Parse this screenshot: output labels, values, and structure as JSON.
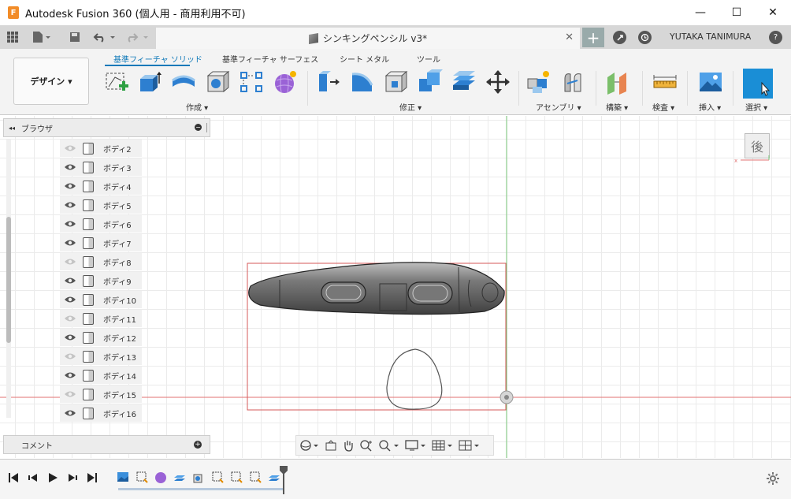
{
  "window": {
    "app_title": "Autodesk Fusion 360 (個人用 - 商用利用不可)",
    "logo_letter": "F",
    "minimize": "—",
    "maximize": "☐",
    "close": "✕"
  },
  "tabs": {
    "document_title": "シンキングペンシル v3*",
    "close": "✕",
    "new_tab": "+",
    "user_name": "YUTAKA TANIMURA",
    "help": "?"
  },
  "ribbon": {
    "workspace": "デザイン ▾",
    "tabs": [
      "基準フィーチャ ソリッド",
      "基準フィーチャ サーフェス",
      "シート メタル",
      "ツール"
    ],
    "groups": [
      "作成 ▾",
      "修正 ▾",
      "アセンブリ ▾",
      "構築 ▾",
      "検査 ▾",
      "挿入 ▾",
      "選択 ▾"
    ]
  },
  "browser": {
    "title": "ブラウザ",
    "collapse": "◂◂",
    "minus": "−",
    "bodies": [
      {
        "label": "ボディ2",
        "visible": false
      },
      {
        "label": "ボディ3",
        "visible": true
      },
      {
        "label": "ボディ4",
        "visible": true
      },
      {
        "label": "ボディ5",
        "visible": true
      },
      {
        "label": "ボディ6",
        "visible": true
      },
      {
        "label": "ボディ7",
        "visible": true
      },
      {
        "label": "ボディ8",
        "visible": false
      },
      {
        "label": "ボディ9",
        "visible": true
      },
      {
        "label": "ボディ10",
        "visible": true
      },
      {
        "label": "ボディ11",
        "visible": false
      },
      {
        "label": "ボディ12",
        "visible": true
      },
      {
        "label": "ボディ13",
        "visible": false
      },
      {
        "label": "ボディ14",
        "visible": true
      },
      {
        "label": "ボディ15",
        "visible": false
      },
      {
        "label": "ボディ16",
        "visible": true
      }
    ]
  },
  "comment": {
    "title": "コメント",
    "plus": "+"
  },
  "viewcube": {
    "face": "後"
  },
  "colors": {
    "accent": "#0f79b9",
    "tab_bar": "#d7d7d7",
    "ribbon_bg": "#f3f3f3",
    "axis_red": "#e07070",
    "axis_green": "#7ac77a",
    "sketch_box": "#d65a5a",
    "body_gray": "#6e6e6e"
  }
}
